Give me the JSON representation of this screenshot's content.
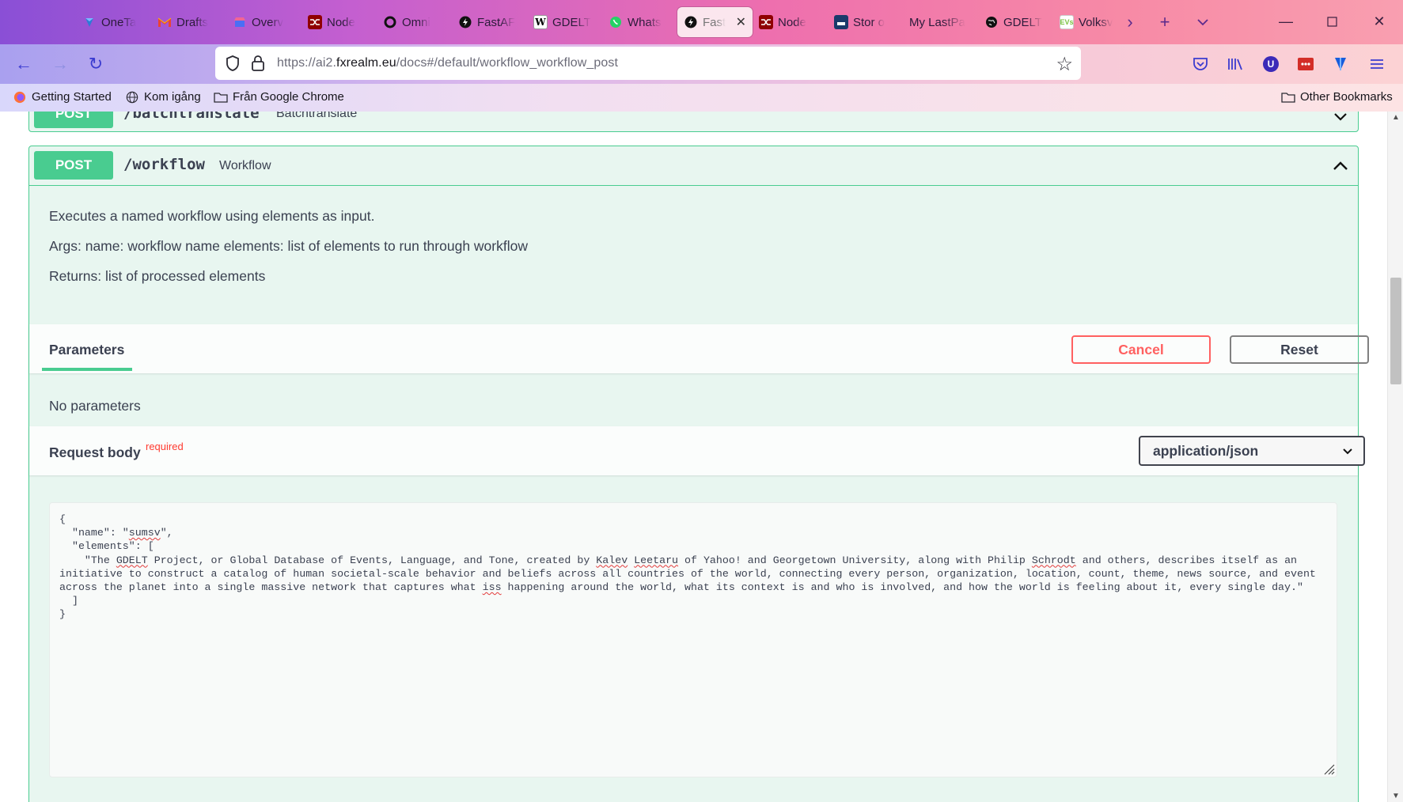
{
  "browser": {
    "tabs": [
      {
        "label": "OneTa",
        "icon": "onetab-icon",
        "color": "#2d7bd6"
      },
      {
        "label": "Drafts",
        "icon": "gmail-icon",
        "color": "#ea4335"
      },
      {
        "label": "Overv",
        "icon": "store-icon",
        "color": "#4c6ef5"
      },
      {
        "label": "Node",
        "icon": "node-red-icon",
        "color": "#8f0000"
      },
      {
        "label": "Omni",
        "icon": "omni-icon",
        "color": "#111111"
      },
      {
        "label": "FastAF",
        "icon": "fastapi-icon",
        "color": "#111111"
      },
      {
        "label": "GDELT",
        "icon": "wikipedia-icon",
        "color": "#ffffff"
      },
      {
        "label": "Whats",
        "icon": "whatsapp-icon",
        "color": "#25d366"
      },
      {
        "label": "Fast",
        "icon": "fastapi-icon",
        "color": "#111111",
        "active": true
      },
      {
        "label": "Node",
        "icon": "node-red-icon",
        "color": "#8f0000"
      },
      {
        "label": "Stor o",
        "icon": "storage-icon",
        "color": "#1a3a6b"
      },
      {
        "label": "My LastPa",
        "icon": "",
        "color": ""
      },
      {
        "label": "GDELT",
        "icon": "globe-icon",
        "color": "#111111"
      },
      {
        "label": "Volksv",
        "icon": "evs-icon",
        "color": "#7cc242"
      }
    ],
    "active_tab_close": "✕",
    "url": {
      "prefix": "https://ai2.",
      "domain": "fxrealm.eu",
      "suffix": "/docs#/default/workflow_workflow_post"
    },
    "bookmarks": {
      "getting_started": "Getting Started",
      "kom_igang": "Kom igång",
      "fran_google": "Från Google Chrome",
      "other": "Other Bookmarks"
    }
  },
  "page": {
    "prev_op": {
      "method": "POST",
      "path": "/batchtranslate",
      "summary": "Batchtranslate"
    },
    "op": {
      "method": "POST",
      "path": "/workflow",
      "summary": "Workflow",
      "description": [
        "Executes a named workflow using elements as input.",
        "Args: name: workflow name elements: list of elements to run through workflow",
        "Returns: list of processed elements"
      ],
      "params_tab": "Parameters",
      "cancel_label": "Cancel",
      "reset_label": "Reset",
      "no_params": "No parameters",
      "request_body_label": "Request body",
      "required_label": "required",
      "content_type": "application/json",
      "body": {
        "l1": "{",
        "l2a": "  \"name\": \"",
        "name_value": "sumsv",
        "l2b": "\",",
        "l3": "  \"elements\": [",
        "t1": "    \"The ",
        "w_gdelt": "GDELT",
        "t2": " Project, or Global Database of Events, Language, and Tone, created by ",
        "w_kalev": "Kalev",
        "t3": " ",
        "w_leetaru": "Leetaru",
        "t4": " of Yahoo! and Georgetown University, along with Philip ",
        "w_schrodt": "Schrodt",
        "t5": " and others, describes itself as an initiative to construct a catalog of human societal-scale behavior and beliefs across all countries of the world, connecting every person, organization, location, count, theme, news source, and event across the planet into a single massive network that captures what ",
        "w_iss": "iss",
        "t6": " happening around the world, what its context is and who is involved, and how the world is feeling about it, every single day.\"",
        "l5": "  ]",
        "l6": "}"
      }
    }
  },
  "colors": {
    "post_green": "#49cc90",
    "op_bg": "#e8f6f0",
    "cancel_red": "#ff6060",
    "required_red": "#ff3b30"
  }
}
